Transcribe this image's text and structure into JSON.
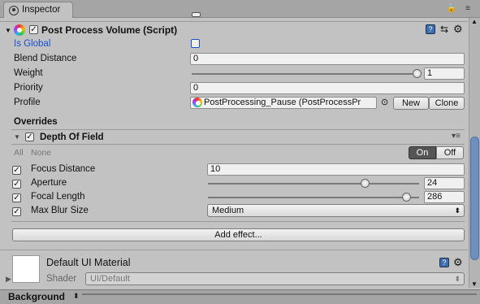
{
  "window": {
    "tab_title": "Inspector"
  },
  "component": {
    "title": "Post Process Volume (Script)",
    "is_global_label": "Is Global",
    "is_global": false,
    "blend_distance_label": "Blend Distance",
    "blend_distance": "0",
    "weight_label": "Weight",
    "weight": "1",
    "weight_fraction": 1.0,
    "priority_label": "Priority",
    "priority": "0",
    "profile_label": "Profile",
    "profile_value": "PostProcessing_Pause (PostProcessPr",
    "new_label": "New",
    "clone_label": "Clone"
  },
  "overrides": {
    "header": "Overrides",
    "effect_title": "Depth Of Field",
    "all_label": "All",
    "none_label": "None",
    "on_label": "On",
    "off_label": "Off",
    "focus_distance_label": "Focus Distance",
    "focus_distance": "10",
    "aperture_label": "Aperture",
    "aperture": "24",
    "aperture_fraction": 0.75,
    "focal_length_label": "Focal Length",
    "focal_length": "286",
    "focal_length_fraction": 0.95,
    "max_blur_label": "Max Blur Size",
    "max_blur_value": "Medium"
  },
  "add_effect_label": "Add effect...",
  "material": {
    "name": "Default UI Material",
    "shader_label": "Shader",
    "shader_value": "UI/Default"
  },
  "footer": {
    "label": "Background"
  },
  "colors": {
    "accent": "#6f8fbf",
    "blue_label": "#1a4fd6"
  }
}
